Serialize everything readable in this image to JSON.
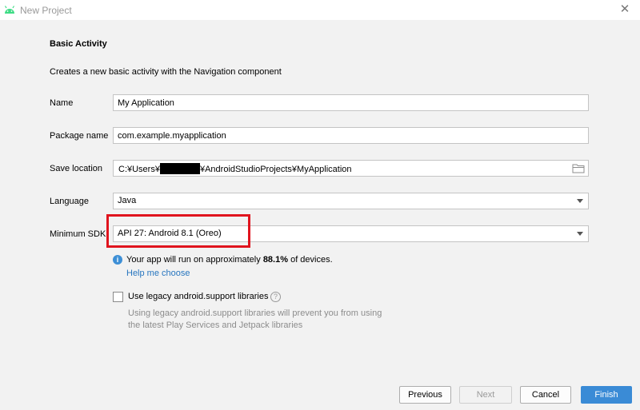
{
  "window": {
    "title": "New Project"
  },
  "form": {
    "heading": "Basic Activity",
    "description": "Creates a new basic activity with the Navigation component",
    "name": {
      "label": "Name",
      "value": "My Application"
    },
    "package": {
      "label": "Package name",
      "value": "com.example.myapplication"
    },
    "save_location": {
      "label": "Save location",
      "value_prefix": "C:¥Users¥",
      "value_suffix": "¥AndroidStudioProjects¥MyApplication"
    },
    "language": {
      "label": "Language",
      "value": "Java"
    },
    "min_sdk": {
      "label": "Minimum SDK",
      "value": "API 27: Android 8.1 (Oreo)"
    },
    "info": {
      "text_prefix": "Your app will run on approximately ",
      "percent": "88.1%",
      "text_suffix": " of devices.",
      "help_link": "Help me choose"
    },
    "legacy": {
      "label": "Use legacy android.support libraries",
      "note_line1": "Using legacy android.support libraries will prevent you from using",
      "note_line2": "the latest Play Services and Jetpack libraries",
      "checked": false
    }
  },
  "buttons": {
    "previous": "Previous",
    "next": "Next",
    "cancel": "Cancel",
    "finish": "Finish"
  },
  "colors": {
    "accent": "#3a8bd6",
    "link": "#2675bf",
    "highlight": "#e0141e",
    "android_green": "#3ddc84"
  }
}
